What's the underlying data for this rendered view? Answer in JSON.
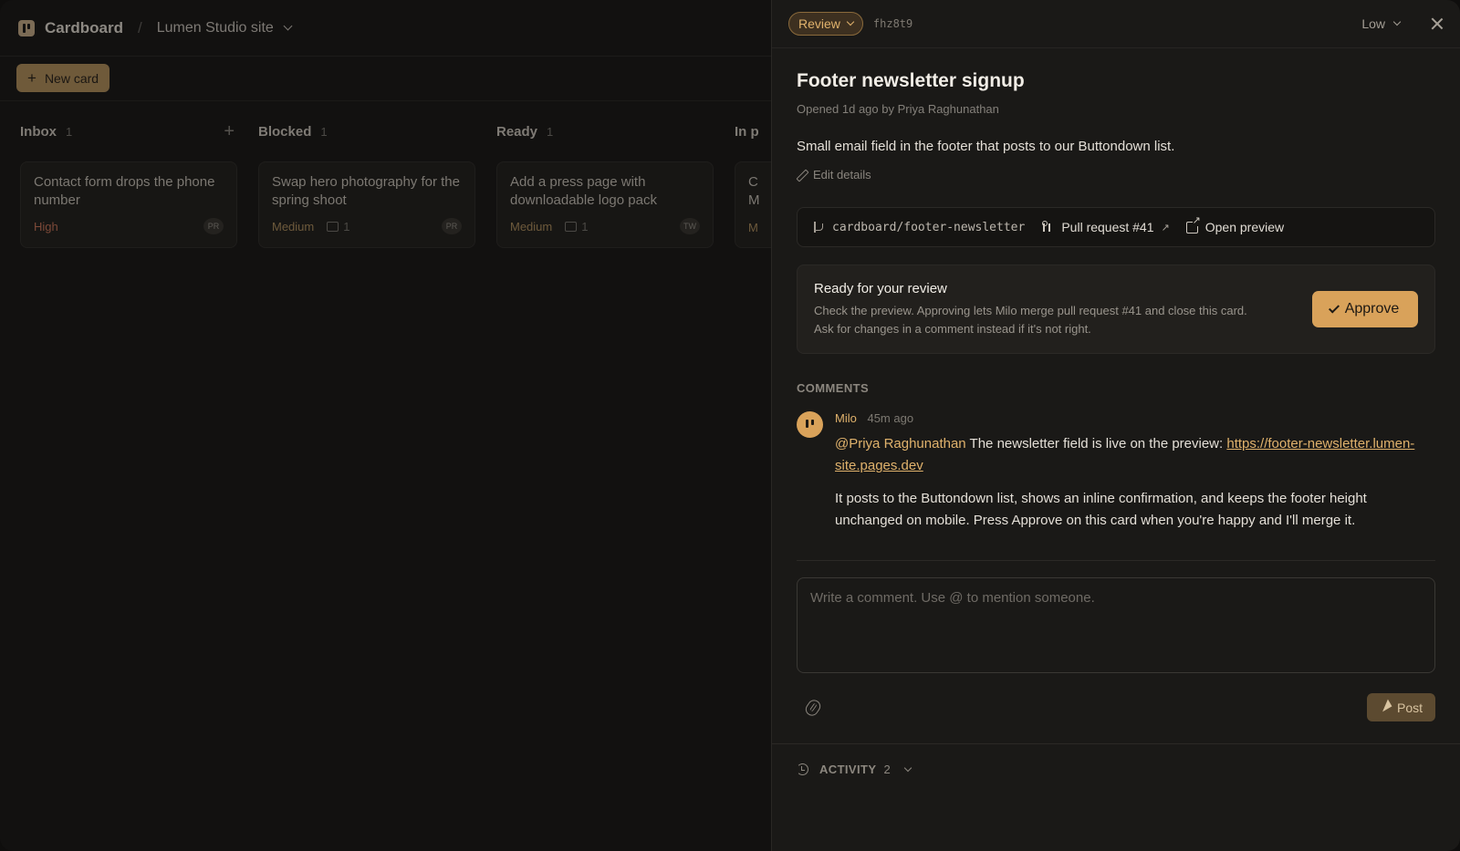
{
  "app": {
    "name": "Cardboard",
    "project": "Lumen Studio site",
    "breadcrumb_sep": "/"
  },
  "toolbar": {
    "new_card_label": "New card"
  },
  "columns": [
    {
      "title": "Inbox",
      "count": "1",
      "cards": [
        {
          "title": "Contact form drops the phone number",
          "priority": "High",
          "avatar": "PR"
        }
      ]
    },
    {
      "title": "Blocked",
      "count": "1",
      "cards": [
        {
          "title": "Swap hero photography for the spring shoot",
          "priority": "Medium",
          "comments": "1",
          "avatar": "PR"
        }
      ]
    },
    {
      "title": "Ready",
      "count": "1",
      "cards": [
        {
          "title": "Add a press page with downloadable logo pack",
          "priority": "Medium",
          "comments": "1",
          "avatar": "TW"
        }
      ]
    },
    {
      "title": "In p",
      "cards": [
        {
          "title_fragment": [
            "C",
            "M"
          ],
          "priority_fragment": "M"
        }
      ]
    }
  ],
  "drawer": {
    "status": "Review",
    "card_id": "fhz8t9",
    "priority": "Low",
    "title": "Footer newsletter signup",
    "opened": "Opened 1d ago by Priya Raghunathan",
    "description": "Small email field in the footer that posts to our Buttondown list.",
    "edit_label": "Edit details",
    "links": {
      "branch": "cardboard/footer-newsletter",
      "pull_request": "Pull request #41",
      "preview": "Open preview"
    },
    "review": {
      "title": "Ready for your review",
      "line1": "Check the preview. Approving lets Milo merge pull request #41 and close this card.",
      "line2": "Ask for changes in a comment instead if it's not right.",
      "approve_label": "Approve"
    },
    "comments_label": "COMMENTS",
    "comments": [
      {
        "author": "Milo",
        "time": "45m ago",
        "mention": "@Priya Raghunathan",
        "text1": " The newsletter field is live on the preview: ",
        "link": "https://footer-newsletter.lumen-site.pages.dev",
        "text2": "It posts to the Buttondown list, shows an inline confirmation, and keeps the footer height unchanged on mobile. Press Approve on this card when you're happy and I'll merge it."
      }
    ],
    "composer": {
      "placeholder": "Write a comment. Use @ to mention someone.",
      "post_label": "Post"
    },
    "activity": {
      "label": "ACTIVITY",
      "count": "2"
    }
  },
  "colors": {
    "accent": "#d9a25a",
    "background": "#121110",
    "panel": "#1a1917",
    "priority_high": "#7d4938"
  }
}
